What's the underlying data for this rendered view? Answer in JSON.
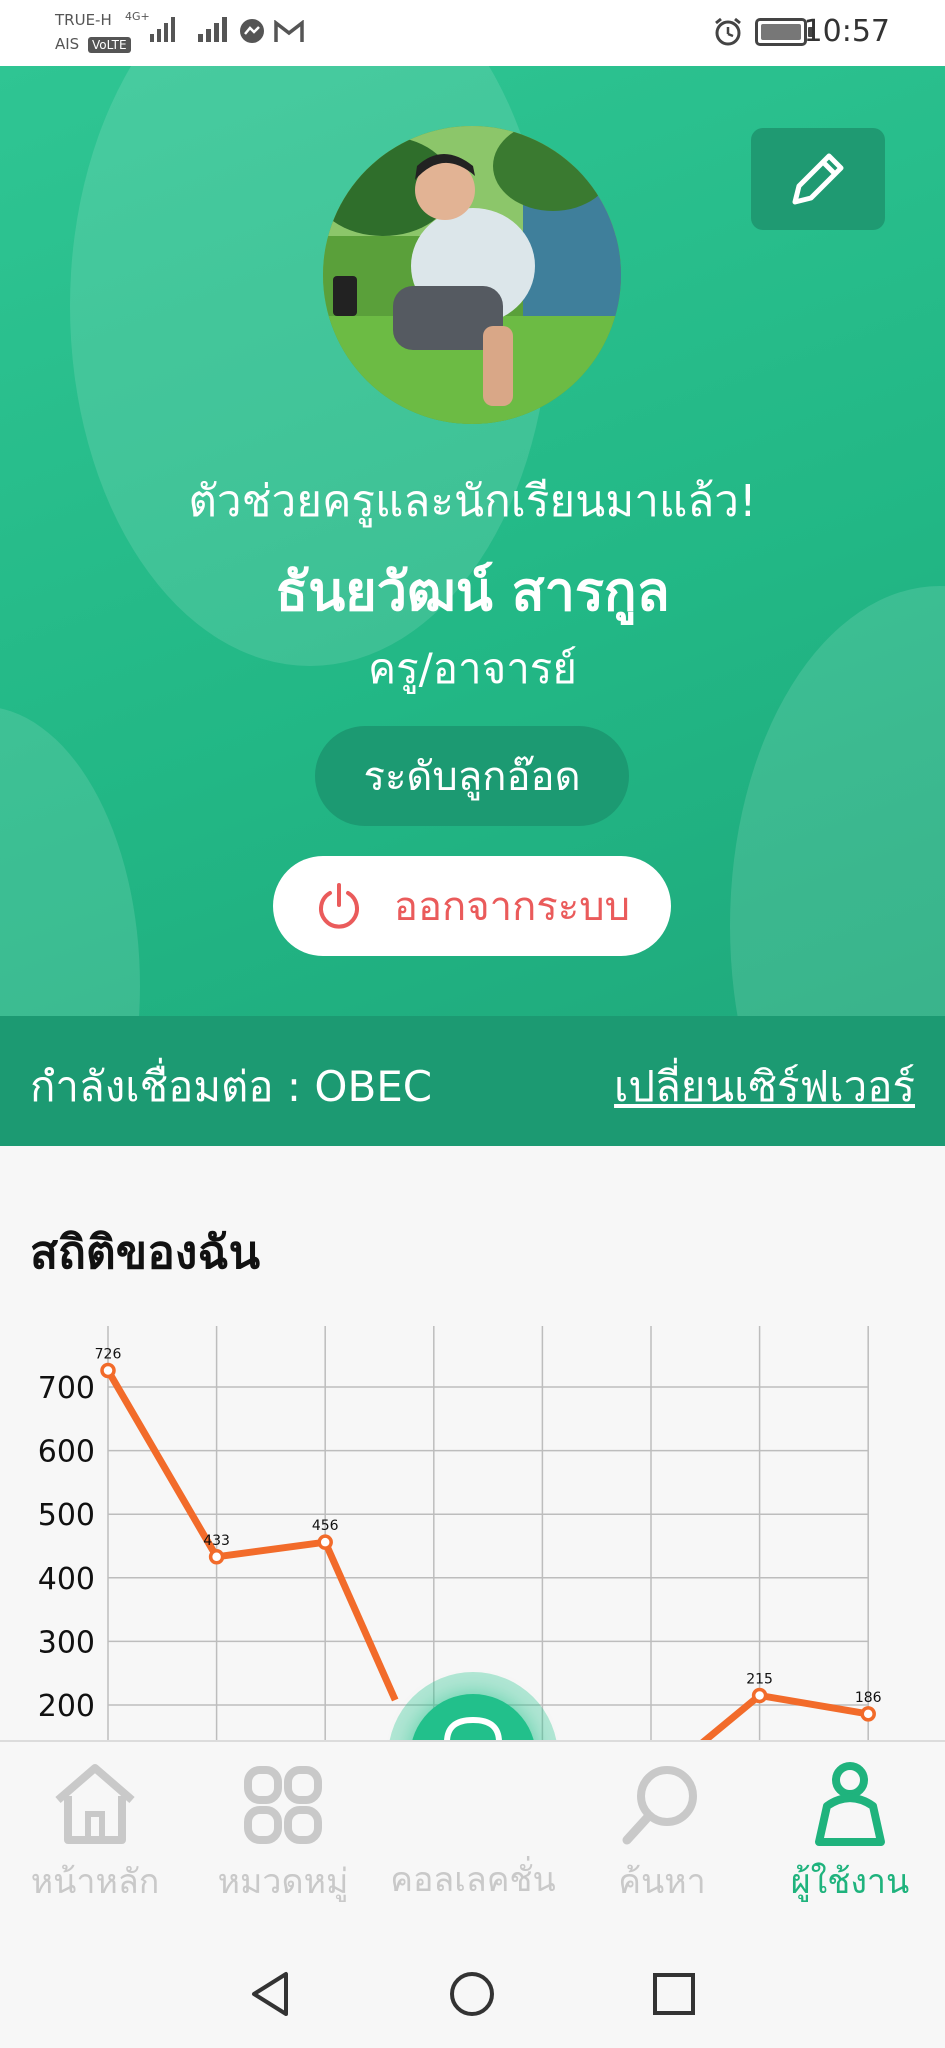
{
  "status_bar": {
    "carrier_1": "TRUE-H",
    "carrier_2": "AIS",
    "volte": "VoLTE",
    "network": "4G+",
    "time": "10:57"
  },
  "profile": {
    "greeting": "ตัวช่วยครูและนักเรียนมาแล้ว!",
    "name": "ธันยวัฒน์ สารกูล",
    "role": "ครู/อาจารย์",
    "level": "ระดับลูกอ๊อด",
    "logout_label": "ออกจากระบบ"
  },
  "server": {
    "status_label": "กำลังเชื่อมต่อ : OBEC",
    "change_label": "เปลี่ยนเซิร์ฟเวอร์"
  },
  "stats": {
    "title": "สถิติของฉัน"
  },
  "chart_data": {
    "type": "line",
    "x": [
      0,
      1,
      2,
      3,
      4,
      5,
      6,
      7
    ],
    "values": [
      726,
      433,
      456,
      null,
      null,
      null,
      215,
      186
    ],
    "y_ticks": [
      200,
      300,
      400,
      500,
      600,
      700
    ],
    "ylim": [
      150,
      750
    ],
    "grid": true,
    "color": "#f26b2a"
  },
  "bottom_nav": {
    "items": [
      {
        "label": "หน้าหลัก",
        "icon": "home-icon"
      },
      {
        "label": "หมวดหมู่",
        "icon": "category-icon"
      },
      {
        "label": "คอลเลคชั่น",
        "icon": "collection-icon"
      },
      {
        "label": "ค้นหา",
        "icon": "search-icon"
      },
      {
        "label": "ผู้ใช้งาน",
        "icon": "user-icon"
      }
    ],
    "active_index": 4,
    "active_color": "#1fb37d"
  }
}
